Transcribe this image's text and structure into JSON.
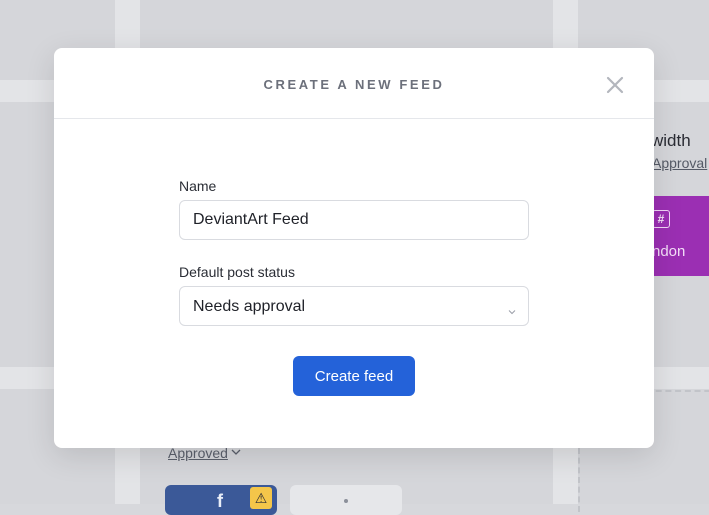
{
  "background": {
    "width_label": "width",
    "approval_link": "Approval",
    "purple_card_text": "ndon",
    "purple_card_icon": "#",
    "approved_link": "Approved",
    "approved_chevron": "⌄",
    "facebook_icon": "f",
    "warning_icon": "⚠",
    "accent_purple": "#9b2fb3"
  },
  "modal": {
    "title": "CREATE A NEW FEED",
    "close_icon": "close-icon",
    "name_label": "Name",
    "name_value": "DeviantArt Feed",
    "status_label": "Default post status",
    "status_value": "Needs approval",
    "submit_label": "Create feed",
    "accent_color": "#2462d9"
  }
}
